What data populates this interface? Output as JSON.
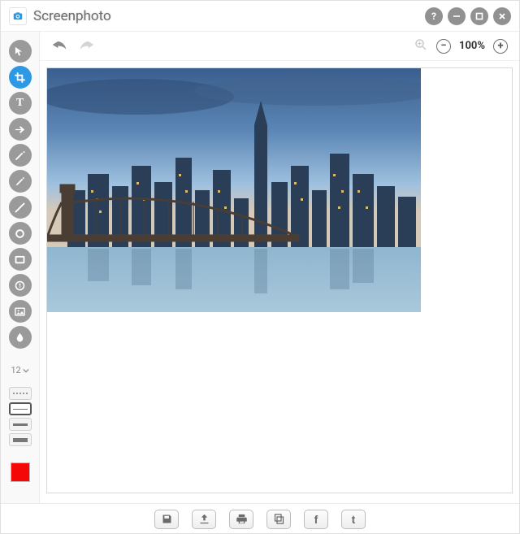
{
  "app": {
    "title": "Screenphoto"
  },
  "zoom": {
    "level": "100%"
  },
  "sidebar": {
    "size_value": "12",
    "active_tool": "crop",
    "selected_stroke": "thin",
    "color": "#f50808"
  }
}
